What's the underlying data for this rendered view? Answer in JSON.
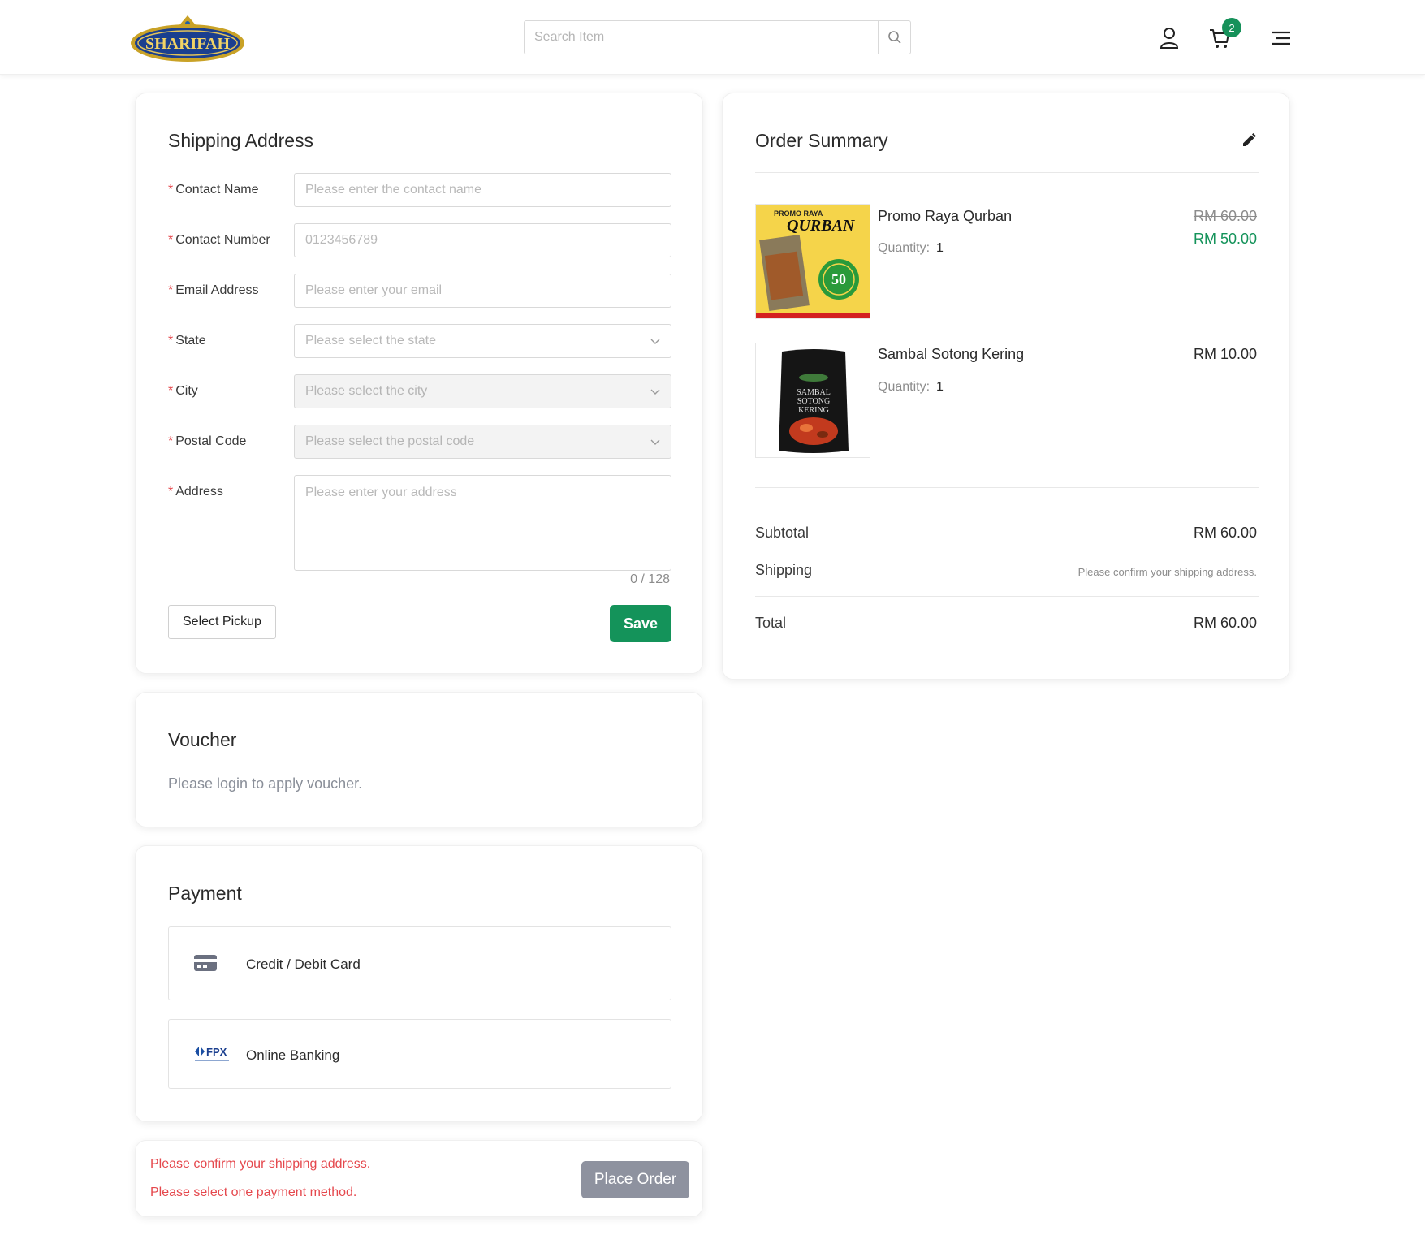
{
  "header": {
    "logo_text": "SHARIFAH",
    "search_placeholder": "Search Item",
    "cart_count": "2"
  },
  "shipping": {
    "title": "Shipping Address",
    "fields": {
      "contact_name": {
        "label": "Contact Name",
        "placeholder": "Please enter the contact name"
      },
      "contact_number": {
        "label": "Contact Number",
        "placeholder": "0123456789"
      },
      "email": {
        "label": "Email Address",
        "placeholder": "Please enter your email"
      },
      "state": {
        "label": "State",
        "placeholder": "Please select the state"
      },
      "city": {
        "label": "City",
        "placeholder": "Please select the city"
      },
      "postal_code": {
        "label": "Postal Code",
        "placeholder": "Please select the postal code"
      },
      "address": {
        "label": "Address",
        "placeholder": "Please enter your address",
        "counter": "0 / 128"
      }
    },
    "select_pickup_label": "Select Pickup",
    "save_label": "Save"
  },
  "voucher": {
    "title": "Voucher",
    "message": "Please login to apply voucher."
  },
  "payment": {
    "title": "Payment",
    "methods": [
      {
        "label": "Credit / Debit Card",
        "icon": "credit-card-icon"
      },
      {
        "label": "Online Banking",
        "icon": "fpx-logo"
      }
    ],
    "fpx_logo_text": "FPX"
  },
  "place_order": {
    "errors": [
      "Please confirm your shipping address.",
      "Please select one payment method."
    ],
    "button_label": "Place Order"
  },
  "order_summary": {
    "title": "Order Summary",
    "items": [
      {
        "name": "Promo Raya Qurban",
        "quantity_label": "Quantity:",
        "quantity": "1",
        "old_price": "RM 60.00",
        "price": "RM 50.00",
        "image_text": {
          "top": "PROMO RAYA",
          "main": "QURBAN",
          "badge": "50"
        }
      },
      {
        "name": "Sambal Sotong Kering",
        "quantity_label": "Quantity:",
        "quantity": "1",
        "price": "RM 10.00",
        "image_text": {
          "l1": "SAMBAL",
          "l2": "SOTONG",
          "l3": "KERING"
        }
      }
    ],
    "subtotal_label": "Subtotal",
    "subtotal": "RM 60.00",
    "shipping_label": "Shipping",
    "shipping_note": "Please confirm your shipping address.",
    "total_label": "Total",
    "total": "RM 60.00"
  },
  "colors": {
    "accent_green": "#14935a",
    "error_red": "#e5484d",
    "disabled_button": "#8e929f"
  }
}
